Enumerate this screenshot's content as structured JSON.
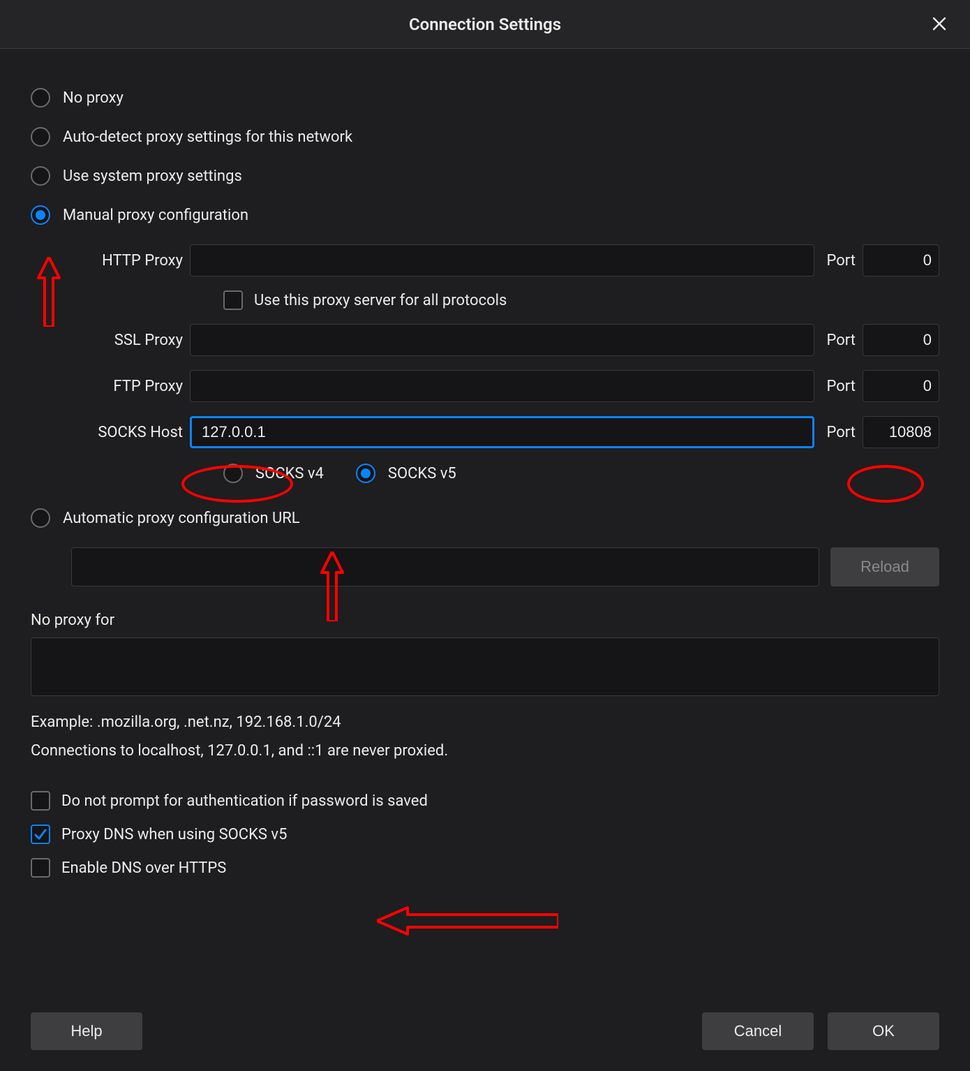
{
  "header": {
    "title": "Connection Settings"
  },
  "proxy_mode": {
    "options": {
      "no_proxy": "No proxy",
      "auto_detect": "Auto-detect proxy settings for this network",
      "system": "Use system proxy settings",
      "manual": "Manual proxy configuration",
      "auto_url": "Automatic proxy configuration URL"
    },
    "selected": "manual"
  },
  "manual": {
    "http": {
      "label": "HTTP Proxy",
      "host": "",
      "port_label": "Port",
      "port": "0"
    },
    "use_for_all_label": "Use this proxy server for all protocols",
    "use_for_all_checked": false,
    "ssl": {
      "label": "SSL Proxy",
      "host": "",
      "port_label": "Port",
      "port": "0"
    },
    "ftp": {
      "label": "FTP Proxy",
      "host": "",
      "port_label": "Port",
      "port": "0"
    },
    "socks": {
      "label": "SOCKS Host",
      "host": "127.0.0.1",
      "port_label": "Port",
      "port": "10808"
    },
    "socks_versions": {
      "v4": "SOCKS v4",
      "v5": "SOCKS v5",
      "selected": "v5"
    }
  },
  "auto_url": {
    "url": "",
    "reload_label": "Reload"
  },
  "no_proxy_for": {
    "label": "No proxy for",
    "value": "",
    "example": "Example: .mozilla.org, .net.nz, 192.168.1.0/24",
    "note": "Connections to localhost, 127.0.0.1, and ::1 are never proxied."
  },
  "checkboxes": {
    "no_prompt_auth": {
      "label": "Do not prompt for authentication if password is saved",
      "checked": false
    },
    "proxy_dns_socks5": {
      "label": "Proxy DNS when using SOCKS v5",
      "checked": true
    },
    "dns_over_https": {
      "label": "Enable DNS over HTTPS",
      "checked": false
    }
  },
  "buttons": {
    "help": "Help",
    "cancel": "Cancel",
    "ok": "OK"
  }
}
